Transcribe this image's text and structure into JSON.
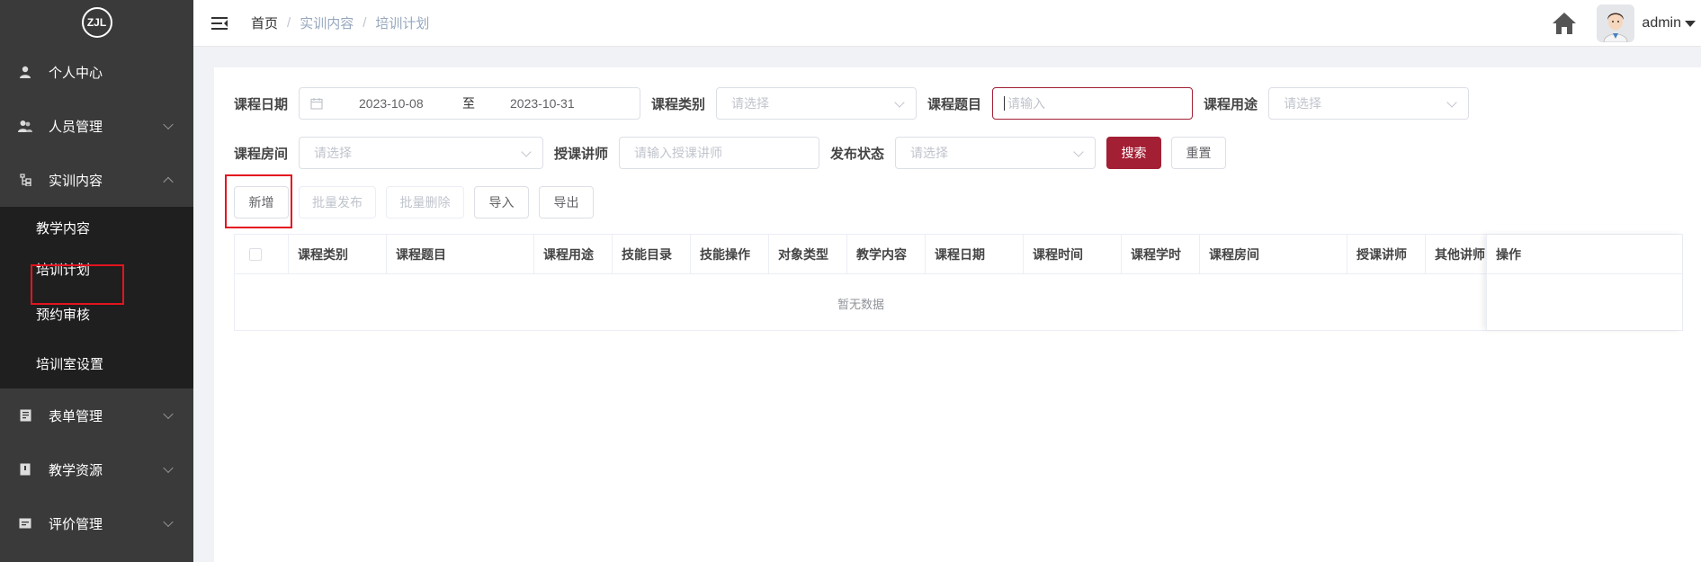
{
  "sidebar": {
    "logo_text": "ZJL",
    "items": [
      {
        "label": "个人中心",
        "icon": "user-icon"
      },
      {
        "label": "人员管理",
        "icon": "users-icon"
      },
      {
        "label": "实训内容",
        "icon": "tree-icon"
      },
      {
        "label": "表单管理",
        "icon": "form-icon"
      },
      {
        "label": "教学资源",
        "icon": "book-icon"
      },
      {
        "label": "评价管理",
        "icon": "rating-icon"
      }
    ],
    "submenu": [
      "教学内容",
      "培训计划",
      "预约审核",
      "培训室设置"
    ]
  },
  "header": {
    "breadcrumb": [
      "首页",
      "实训内容",
      "培训计划"
    ],
    "username": "admin"
  },
  "filters": {
    "date_label": "课程日期",
    "date_start": "2023-10-08",
    "date_sep": "至",
    "date_end": "2023-10-31",
    "category_label": "课程类别",
    "category_placeholder": "请选择",
    "topic_label": "课程题目",
    "topic_placeholder": "请输入",
    "purpose_label": "课程用途",
    "purpose_placeholder": "请选择",
    "room_label": "课程房间",
    "room_placeholder": "请选择",
    "teacher_label": "授课讲师",
    "teacher_placeholder": "请输入授课讲师",
    "status_label": "发布状态",
    "status_placeholder": "请选择",
    "search_btn": "搜索",
    "reset_btn": "重置"
  },
  "toolbar": {
    "add": "新增",
    "batch_publish": "批量发布",
    "batch_delete": "批量删除",
    "import": "导入",
    "export": "导出"
  },
  "table": {
    "columns": [
      "课程类别",
      "课程题目",
      "课程用途",
      "技能目录",
      "技能操作",
      "对象类型",
      "教学内容",
      "课程日期",
      "课程时间",
      "课程学时",
      "课程房间",
      "授课讲师",
      "其他讲师"
    ],
    "action_column": "操作",
    "empty_text": "暂无数据"
  },
  "colors": {
    "primary": "#a31f34",
    "sidebar_bg": "#3a3a3a",
    "submenu_bg": "#1f1f1f",
    "highlight_box": "#e3141f"
  }
}
